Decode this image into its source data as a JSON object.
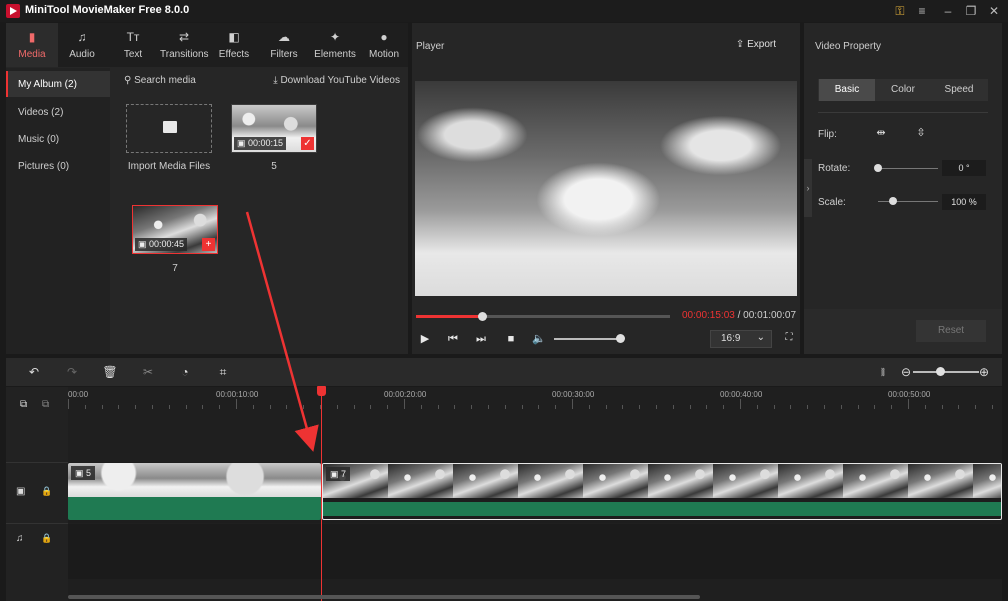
{
  "app": {
    "title": "MiniTool MovieMaker Free 8.0.0"
  },
  "window_controls": {
    "key_icon": "key-icon",
    "menu_icon": "hamburger-icon",
    "minimize": "–",
    "maximize": "❐",
    "close": "✕"
  },
  "media_tabs": [
    {
      "label": "Media",
      "icon": "▮"
    },
    {
      "label": "Audio",
      "icon": "♫"
    },
    {
      "label": "Text",
      "icon": "Tт"
    },
    {
      "label": "Transitions",
      "icon": "⇄"
    },
    {
      "label": "Effects",
      "icon": "◧"
    },
    {
      "label": "Filters",
      "icon": "☁"
    },
    {
      "label": "Elements",
      "icon": "✦"
    },
    {
      "label": "Motion",
      "icon": "●"
    }
  ],
  "media_sidebar": [
    {
      "label": "My Album  (2)"
    },
    {
      "label": "Videos  (2)"
    },
    {
      "label": "Music  (0)"
    },
    {
      "label": "Pictures  (0)"
    }
  ],
  "media_content": {
    "search_placeholder": "Search media",
    "download_label": "Download YouTube Videos",
    "import_label": "Import Media Files",
    "clips": [
      {
        "name": "5",
        "duration": "00:00:15"
      },
      {
        "name": "7",
        "duration": "00:00:45"
      }
    ]
  },
  "player": {
    "title": "Player",
    "export_label": "Export",
    "current_time": "00:00:15:03",
    "separator": " / ",
    "total_time": "00:01:00:07",
    "aspect_ratio": "16:9",
    "progress": 0.26,
    "volume": 0.9
  },
  "properties": {
    "title": "Video Property",
    "tabs": [
      "Basic",
      "Color",
      "Speed"
    ],
    "flip_label": "Flip:",
    "rotate_label": "Rotate:",
    "rotate_value": "0 °",
    "rotate_level": 0.0,
    "scale_label": "Scale:",
    "scale_value": "100 %",
    "scale_level": 0.25,
    "reset_label": "Reset"
  },
  "timeline": {
    "ruler_labels": [
      "00:00",
      "00:00:10:00",
      "00:00:20:00",
      "00:00:30:00",
      "00:00:40:00",
      "00:00:50:00"
    ],
    "zoom_level": 0.45,
    "clips": [
      {
        "label": "5"
      },
      {
        "label": "7"
      }
    ]
  },
  "colors": {
    "accent": "#e33333",
    "audio_track": "#1f7a52"
  }
}
